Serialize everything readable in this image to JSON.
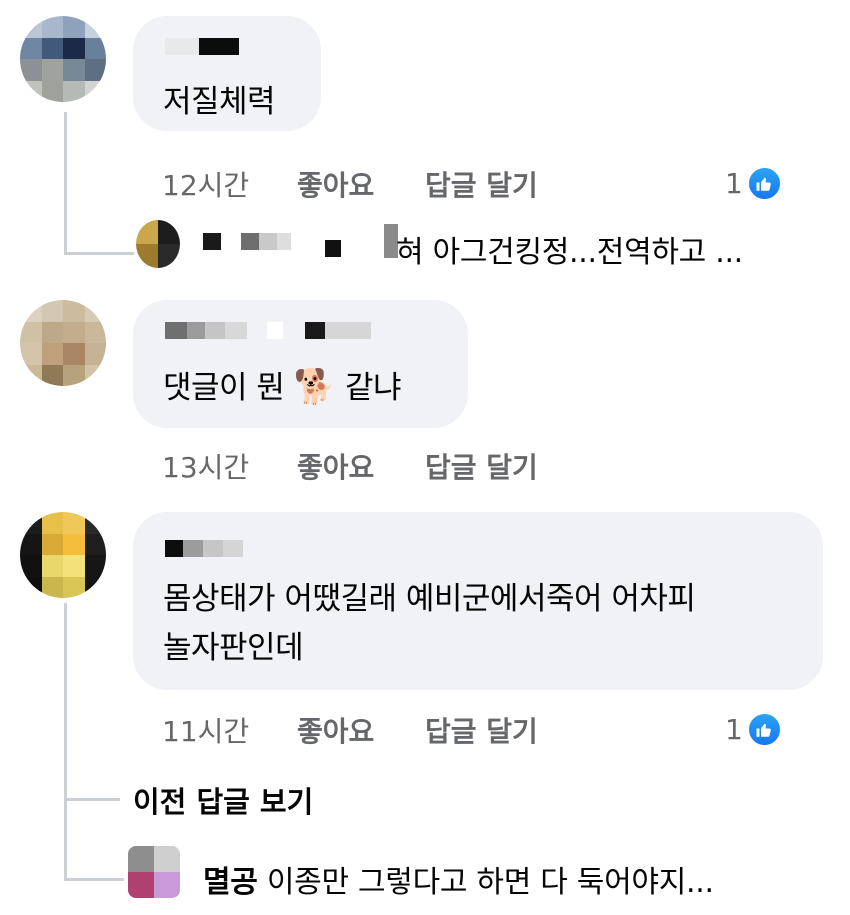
{
  "colors": {
    "bubble": "#f0f2f5",
    "meta": "#65676b",
    "text": "#050505",
    "like_blue": "#1877f2"
  },
  "comments": [
    {
      "text": "저질체력",
      "time": "12시간",
      "like_label": "좋아요",
      "reply_label": "답글 달기",
      "reaction_count": "1",
      "reaction_icon": "like-icon",
      "reply_preview": {
        "name_suffix": "혀",
        "text": "아그건킹정...전역하고 ..."
      }
    },
    {
      "text_before": "댓글이 뭔",
      "emoji": "🐕",
      "text_after": "같냐",
      "time": "13시간",
      "like_label": "좋아요",
      "reply_label": "답글 달기"
    },
    {
      "text_line1": "몸상태가 어땠길래 예비군에서죽어 어차피",
      "text_line2": "놀자판인데",
      "time": "11시간",
      "like_label": "좋아요",
      "reply_label": "답글 달기",
      "reaction_count": "1",
      "reaction_icon": "like-icon",
      "view_previous": "이전 답글 보기",
      "reply_preview": {
        "name": "멸공",
        "text": "이종만 그렇다고 하면 다 둑어야지..."
      }
    }
  ]
}
